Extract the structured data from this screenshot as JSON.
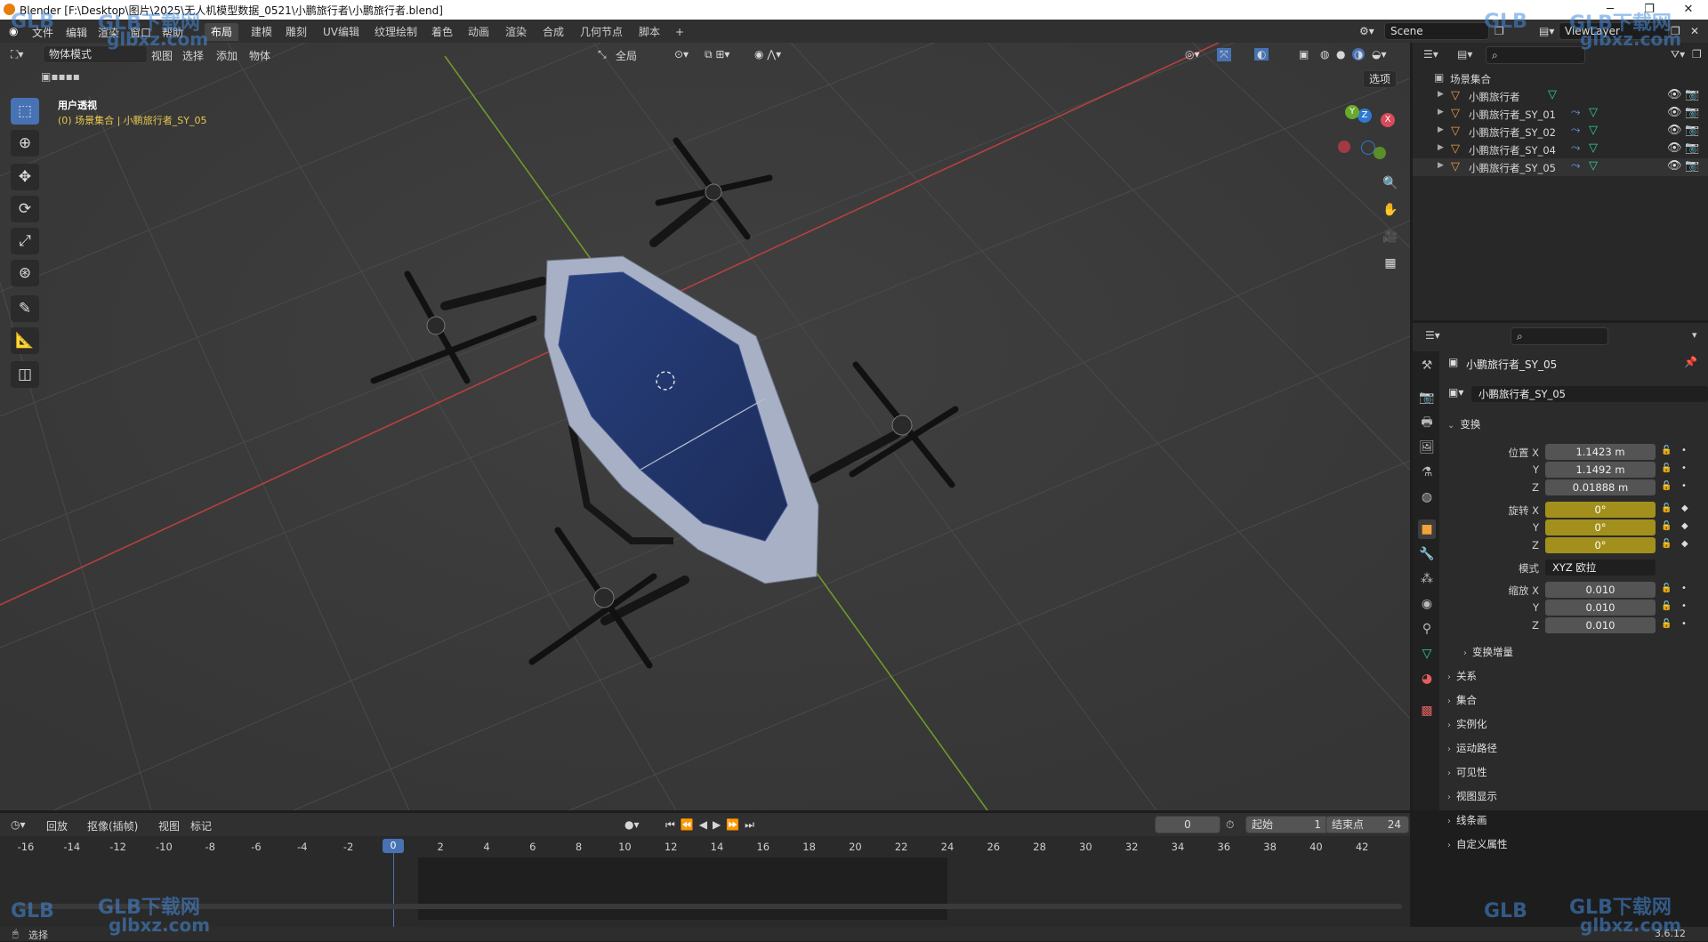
{
  "titlebar": {
    "title": "Blender [F:\\Desktop\\图片\\2025\\无人机模型数据_0521\\小鹏旅行者\\小鹏旅行者.blend]"
  },
  "menu": {
    "items": [
      "文件",
      "编辑",
      "渲染",
      "窗口",
      "帮助"
    ]
  },
  "workspaces": {
    "tabs": [
      "布局",
      "建模",
      "雕刻",
      "UV编辑",
      "纹理绘制",
      "着色",
      "动画",
      "渲染",
      "合成",
      "几何节点",
      "脚本"
    ],
    "add": "+",
    "active": "布局"
  },
  "topright": {
    "scene": "Scene",
    "viewlayer": "ViewLayer"
  },
  "viewport": {
    "mode": "物体模式",
    "menus": [
      "视图",
      "选择",
      "添加",
      "物体"
    ],
    "transform_orientation": "全局",
    "options_label": "选项",
    "view_name": "用户透视",
    "collection_info": "(0) 场景集合 | 小鹏旅行者_SY_05"
  },
  "gizmo": {
    "x": "X",
    "y": "Y",
    "z": "Z"
  },
  "outliner": {
    "root": "场景集合",
    "items": [
      {
        "name": "小鹏旅行者"
      },
      {
        "name": "小鹏旅行者_SY_01"
      },
      {
        "name": "小鹏旅行者_SY_02"
      },
      {
        "name": "小鹏旅行者_SY_04"
      },
      {
        "name": "小鹏旅行者_SY_05"
      }
    ]
  },
  "properties": {
    "object_name": "小鹏旅行者_SY_05",
    "object_field": "小鹏旅行者_SY_05",
    "transform_title": "变换",
    "location_label": "位置 X",
    "location": {
      "x": "1.1423 m",
      "y": "1.1492 m",
      "z": "0.01888 m"
    },
    "rotation_label": "旋转 X",
    "rotation": {
      "x": "0°",
      "y": "0°",
      "z": "0°"
    },
    "mode_label": "模式",
    "mode_value": "XYZ 欧拉",
    "scale_label": "缩放 X",
    "scale": {
      "x": "0.010",
      "y": "0.010",
      "z": "0.010"
    },
    "axis_y": "Y",
    "axis_z": "Z",
    "delta_transform": "变换增量",
    "sections": [
      "关系",
      "集合",
      "实例化",
      "运动路径",
      "可见性",
      "视图显示",
      "线条画",
      "自定义属性"
    ]
  },
  "timeline": {
    "playback": "回放",
    "keying": "抠像(插帧)",
    "view": "视图",
    "marker": "标记",
    "current_frame": "0",
    "start_label": "起始",
    "start": "1",
    "end_label": "结束点",
    "end": "24",
    "ticks": [
      "-16",
      "-14",
      "-12",
      "-10",
      "-8",
      "-6",
      "-4",
      "-2",
      "0",
      "2",
      "4",
      "6",
      "8",
      "10",
      "12",
      "14",
      "16",
      "18",
      "20",
      "22",
      "24",
      "26",
      "28",
      "30",
      "32",
      "34",
      "36",
      "38",
      "40",
      "42"
    ]
  },
  "status": {
    "left": "选择",
    "version": "3.6.12"
  },
  "watermark": {
    "brand": "GLB下载网",
    "url": "glbxz.com",
    "logo": "GLB"
  },
  "colors": {
    "accent": "#4772b3",
    "active_object": "#e79a43",
    "keyframe_yellow": "#a3901c"
  }
}
